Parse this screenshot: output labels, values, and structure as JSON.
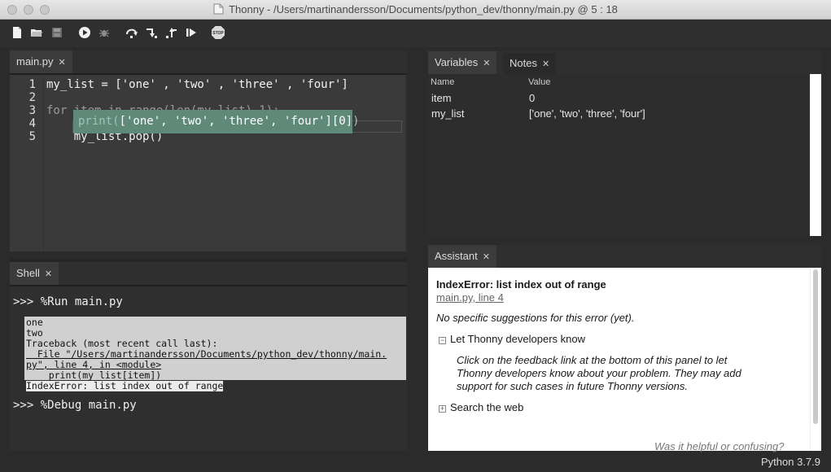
{
  "window": {
    "title": "Thonny  -  /Users/martinandersson/Documents/python_dev/thonny/main.py  @  5 : 18"
  },
  "toolbar": {
    "icons": [
      "new-file-icon",
      "open-file-icon",
      "save-icon",
      "run-icon",
      "debug-icon",
      "step-over-icon",
      "step-into-icon",
      "step-out-icon",
      "resume-icon",
      "stop-icon"
    ],
    "stop_label": "STOP"
  },
  "editor": {
    "tab_label": "main.py",
    "line_numbers": [
      "1",
      "2",
      "3",
      "4",
      "5"
    ],
    "lines": [
      "my_list = ['one' , 'two' , 'three' , 'four']",
      "",
      "for item in range(len(my_list)-1):",
      "",
      "    my_list.pop()"
    ],
    "popup": {
      "prefix": "print(",
      "value": "['one', 'two', 'three', 'four'][0]",
      "suffix": ")"
    }
  },
  "shell": {
    "tab_label": "Shell",
    "run_command": ">>> %Run main.py",
    "output": [
      "one",
      "two",
      "Traceback (most recent call last):",
      "  File \"/Users/martinandersson/Documents/python_dev/thonny/main.",
      "py\", line 4, in <module>",
      "    print(my_list[item])",
      "IndexError: list index out of range"
    ],
    "debug_command": ">>> %Debug main.py"
  },
  "variables": {
    "tab_label": "Variables",
    "notes_tab_label": "Notes",
    "col_name": "Name",
    "col_value": "Value",
    "rows": [
      {
        "name": "item",
        "value": "0"
      },
      {
        "name": "my_list",
        "value": "['one', 'two', 'three', 'four']"
      }
    ]
  },
  "assistant": {
    "tab_label": "Assistant",
    "error_title": "IndexError: list index out of range",
    "location_link": "main.py, line 4",
    "no_suggestions": "No specific suggestions for this error (yet).",
    "section1_toggle": "−",
    "section1_title": "Let Thonny developers know",
    "section1_body": [
      "Click on the feedback link at the bottom of this panel to let",
      "Thonny developers know about your problem. They may add",
      "support for such cases in future Thonny versions."
    ],
    "section2_toggle": "+",
    "section2_title": "Search the web",
    "feedback_link": "Was it helpful or confusing?"
  },
  "status": {
    "python_version": "Python 3.7.9"
  },
  "colors": {
    "popup_bg": "#5f8a7a",
    "editor_bg": "#3a3a3a",
    "shell_bg": "#2f2f2f"
  }
}
